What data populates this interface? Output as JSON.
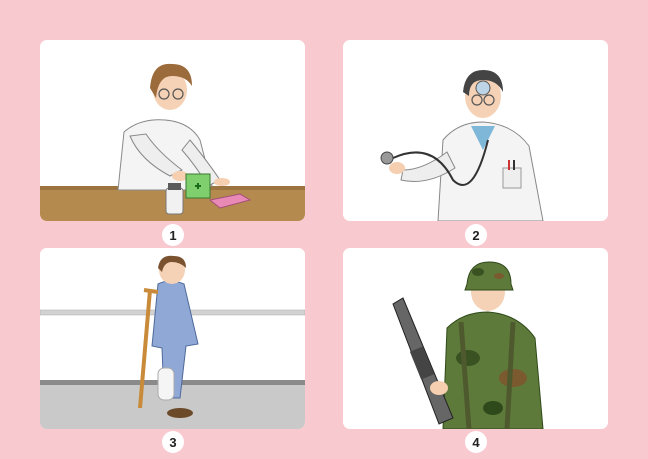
{
  "background_color": "#f9c9d0",
  "panels": [
    {
      "number": "1",
      "subject": "pharmacist-illustration"
    },
    {
      "number": "2",
      "subject": "doctor-illustration"
    },
    {
      "number": "3",
      "subject": "patient-illustration"
    },
    {
      "number": "4",
      "subject": "soldier-illustration"
    }
  ]
}
